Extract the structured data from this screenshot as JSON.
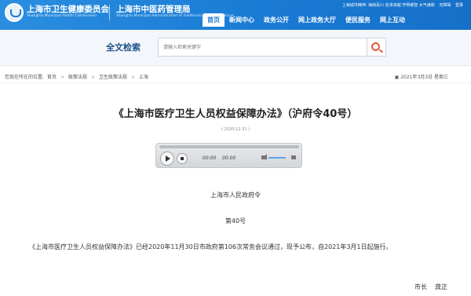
{
  "header": {
    "org1": "上海市卫生健康委员会",
    "org1_en": "Shanghai Municipal Health Commission",
    "org2": "上海市中医药管理局",
    "org2_en": "Shanghai Municipal Administration of Traditional Chinese Medicine",
    "topbar": {
      "spirit": "上海城市精神: 海纳百川 追求卓越 开明睿智 大气谦和",
      "accessibility": "无障碍",
      "login": "登录"
    },
    "nav": [
      {
        "label": "首页",
        "active": true
      },
      {
        "label": "新闻中心"
      },
      {
        "label": "政务公开"
      },
      {
        "label": "网上政务大厅"
      },
      {
        "label": "便民服务"
      },
      {
        "label": "网上互动"
      }
    ]
  },
  "search": {
    "title": "全文检索",
    "placeholder": "请输入检索关键字"
  },
  "breadcrumb": {
    "prefix": "您现在所在的位置:",
    "items": [
      "首页",
      "政策法规",
      "卫生政策法规",
      "上海"
    ],
    "date": "2021年3月3日 星期三"
  },
  "article": {
    "title": "《上海市医疗卫生人员权益保障办法》（沪府令40号）",
    "date": "( 2020-12-31 )",
    "player": {
      "current": "00:00",
      "duration": "00:00"
    },
    "issuer": "上海市人民政府令",
    "number": "第40号",
    "paragraph": "《上海市医疗卫生人员权益保障办法》已经2020年11月30日市政府第106次常务会议通过，现予公布，自2021年3月1日起施行。",
    "sign_title": "市长",
    "sign_name": "龚正"
  }
}
